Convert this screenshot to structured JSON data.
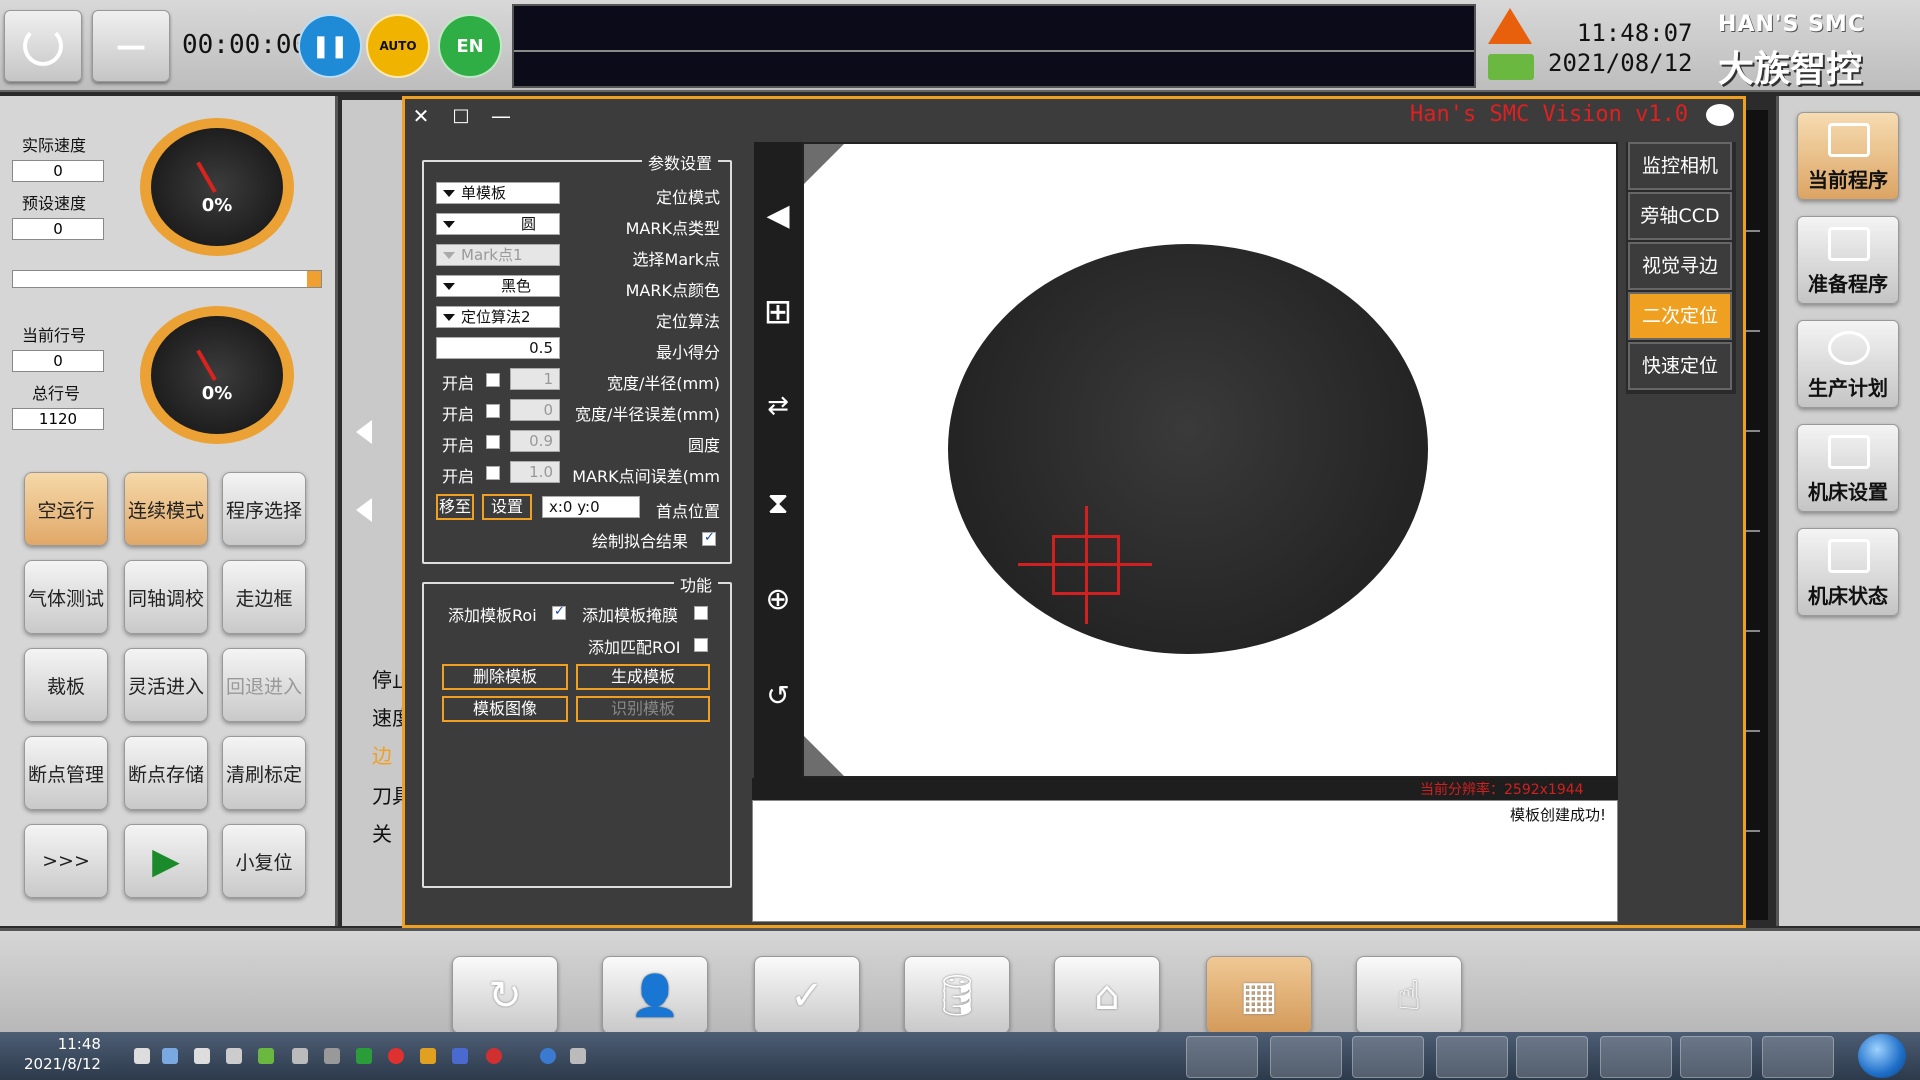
{
  "topbar": {
    "timer": "00:00:00",
    "clock_time": "11:48:07",
    "clock_date": "2021/08/12",
    "brand_en": "HAN'S SMC",
    "brand_cn": "大族智控",
    "buttons": {
      "power_icon": "power-icon",
      "minimize_label": "—",
      "pause_icon": "pause-icon",
      "auto_label": "AUTO",
      "lang_label": "EN"
    }
  },
  "left": {
    "actual_speed_label": "实际速度",
    "actual_speed_value": "0",
    "preset_speed_label": "预设速度",
    "preset_speed_value": "0",
    "gauge1_value": "0%",
    "current_line_label": "当前行号",
    "current_line_value": "0",
    "total_lines_label": "总行号",
    "total_lines_value": "1120",
    "gauge2_value": "0%",
    "buttons": [
      {
        "label": "空运行"
      },
      {
        "label": "连续模式"
      },
      {
        "label": "程序选择"
      },
      {
        "label": "气体测试"
      },
      {
        "label": "同轴调校"
      },
      {
        "label": "走边框"
      },
      {
        "label": "裁板"
      },
      {
        "label": "灵活进入"
      },
      {
        "label": "回退进入"
      },
      {
        "label": "断点管理"
      },
      {
        "label": "断点存储"
      },
      {
        "label": "清刷标定"
      },
      {
        "label": ">>>"
      },
      {
        "label": "▶"
      },
      {
        "label": "小复位"
      }
    ]
  },
  "midstrip": {
    "texts": [
      "停止",
      "速度",
      "边",
      "刀具",
      "关"
    ]
  },
  "dialog": {
    "title": "Han's SMC Vision v1.0",
    "close": "✕",
    "maximize": "□",
    "minimize": "—",
    "params": {
      "group_title": "参数设置",
      "rows": [
        {
          "label": "定位模式",
          "value": "单模板"
        },
        {
          "label": "MARK点类型",
          "value": "圆"
        },
        {
          "label": "选择Mark点",
          "value": "Mark点1"
        },
        {
          "label": "MARK点颜色",
          "value": "黑色"
        },
        {
          "label": "定位算法",
          "value": "定位算法2"
        },
        {
          "label": "最小得分",
          "value": "0.5"
        },
        {
          "label": "宽度/半径(mm)",
          "value": "1",
          "check": "开启"
        },
        {
          "label": "宽度/半径误差(mm)",
          "value": "0",
          "check": "开启"
        },
        {
          "label": "圆度",
          "value": "0.9",
          "check": "开启"
        },
        {
          "label": "MARK点间误差(mm",
          "value": "1.0",
          "check": "开启"
        }
      ],
      "first_point_label": "首点位置",
      "first_point_value": "x:0 y:0",
      "set_label": "设置",
      "move_label": "移至",
      "draw_fit_label": "绘制拟合结果"
    },
    "func": {
      "group_title": "功能",
      "add_template_label": "添加模板掩膜",
      "add_template_roi_label": "添加模板Roi",
      "add_match_roi_label": "添加匹配ROI",
      "gen_template": "生成模板",
      "del_template": "删除模板",
      "recognize_template": "识别模板",
      "template_image": "模板图像"
    },
    "tabs": [
      "监控相机",
      "旁轴CCD",
      "视觉寻边",
      "二次定位",
      "快速定位"
    ],
    "active_tab": "二次定位",
    "resolution_info": "当前分辨率：2592x1944",
    "log_message": "模板创建成功!"
  },
  "right": {
    "buttons": [
      {
        "label": "当前程序",
        "icon": "program-icon"
      },
      {
        "label": "准备程序",
        "icon": "monitor-icon"
      },
      {
        "label": "生产计划",
        "icon": "clock-icon"
      },
      {
        "label": "机床设置",
        "icon": "sliders-icon"
      },
      {
        "label": "机床状态",
        "icon": "chart-icon"
      }
    ]
  },
  "bottom": {
    "buttons": [
      {
        "icon": "reset-icon",
        "glyph": "↻"
      },
      {
        "icon": "user-icon",
        "glyph": "👤"
      },
      {
        "icon": "diagnose-icon",
        "glyph": "✓"
      },
      {
        "icon": "oil-icon",
        "glyph": "🛢"
      },
      {
        "icon": "clean-icon",
        "glyph": "⌂"
      },
      {
        "icon": "parts-icon",
        "glyph": "▦"
      },
      {
        "icon": "hand-icon",
        "glyph": "☝"
      }
    ]
  },
  "taskbar": {
    "time": "11:48",
    "date": "2021/8/12"
  },
  "colors": {
    "accent_orange": "#f0a020",
    "alert_red": "#d02020"
  }
}
